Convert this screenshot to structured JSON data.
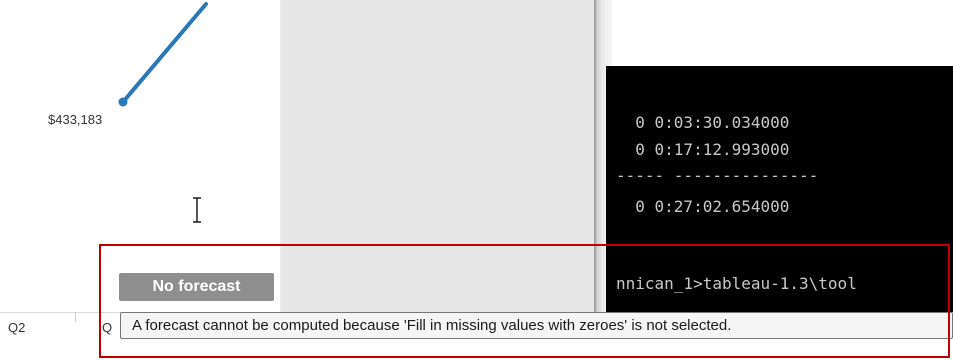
{
  "chart": {
    "data_label": "$433,183",
    "line_color": "#2b78b6",
    "axis_labels": [
      "Q2",
      "Q"
    ]
  },
  "terminal": {
    "lines": [
      "  0 0:03:30.034000",
      "  0 0:17:12.993000",
      "----- ---------------",
      "  0 0:27:02.654000",
      "",
      "",
      "nnican_1>tableau-1.3\\tool"
    ]
  },
  "forecast": {
    "badge_label": "No forecast",
    "tooltip_text": "A forecast cannot be computed because 'Fill in missing values with zeroes' is not selected."
  },
  "annotation": {
    "highlight_color": "#c00000"
  },
  "icons": {
    "cursor": "text-cursor-icon"
  }
}
